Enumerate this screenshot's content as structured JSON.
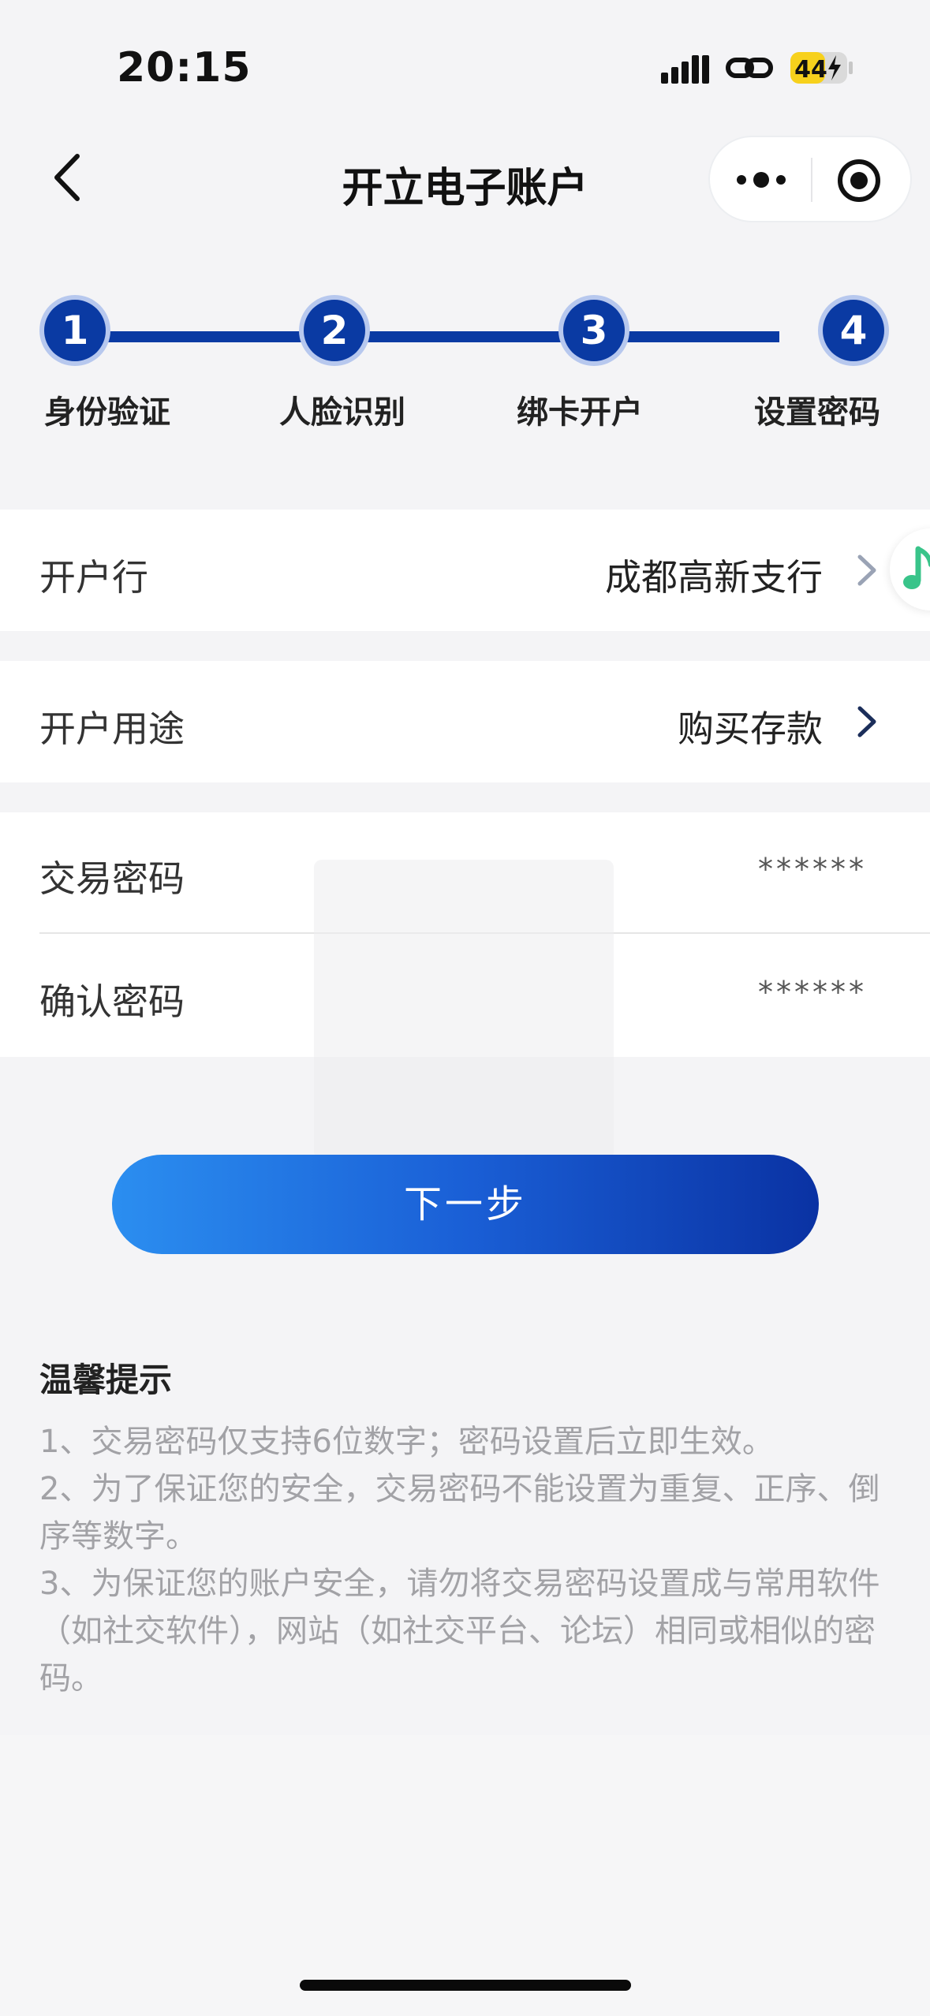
{
  "status_bar": {
    "time": "20:15",
    "battery_level": "44",
    "icons": [
      "signal-icon",
      "link-icon",
      "battery-charging-icon"
    ]
  },
  "nav": {
    "title": "开立电子账户",
    "icons": [
      "back-icon",
      "more-icon",
      "close-target-icon"
    ]
  },
  "stepper": {
    "current_step": 4,
    "steps": [
      {
        "number": "1",
        "label": "身份验证"
      },
      {
        "number": "2",
        "label": "人脸识别"
      },
      {
        "number": "3",
        "label": "绑卡开户"
      },
      {
        "number": "4",
        "label": "设置密码"
      }
    ]
  },
  "form": {
    "branch": {
      "label": "开户行",
      "value": "成都高新支行"
    },
    "purpose": {
      "label": "开户用途",
      "value": "购买存款"
    },
    "trade_password": {
      "label": "交易密码",
      "value": "******"
    },
    "confirm_password": {
      "label": "确认密码",
      "value": "******"
    }
  },
  "next_button": "下一步",
  "tips": {
    "title": "温馨提示",
    "items": [
      "1、交易密码仅支持6位数字；密码设置后立即生效。",
      "2、为了保证您的安全，交易密码不能设置为重复、正序、倒序等数字。",
      "3、为保证您的账户安全，请勿将交易密码设置成与常用软件（如社交软件），网站（如社交平台、论坛）相同或相似的密码。"
    ]
  },
  "colors": {
    "primary": "#0a3aa3",
    "button_gradient_start": "#2b8ef0",
    "button_gradient_end": "#0a32a3",
    "tips_text": "#a2a2a6",
    "battery": "#f7d11c"
  }
}
